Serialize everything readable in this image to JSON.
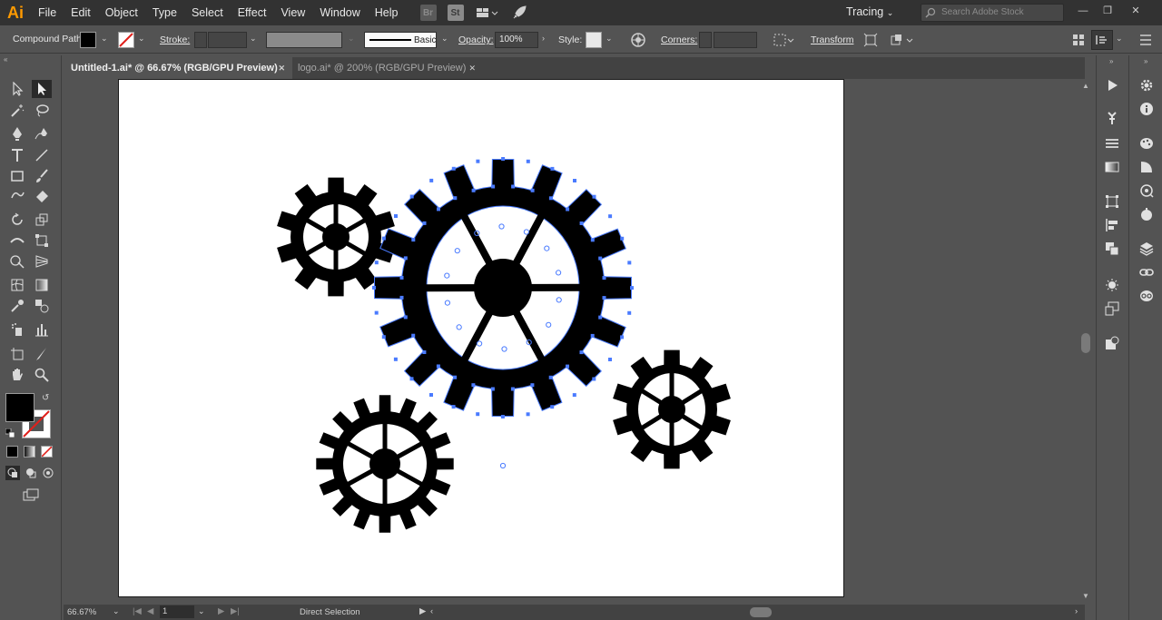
{
  "app": {
    "logo": "Ai"
  },
  "menu": [
    "File",
    "Edit",
    "Object",
    "Type",
    "Select",
    "Effect",
    "View",
    "Window",
    "Help"
  ],
  "menubar_icons": {
    "bridge": "Br",
    "stock": "St"
  },
  "workspace": "Tracing",
  "search_placeholder": "Search Adobe Stock",
  "control": {
    "selection_type": "Compound Path",
    "stroke_label": "Stroke:",
    "brush_label": "Basic",
    "opacity_label": "Opacity:",
    "opacity_value": "100%",
    "style_label": "Style:",
    "corners_label": "Corners:",
    "transform_label": "Transform"
  },
  "tabs": [
    {
      "label": "Untitled-1.ai* @ 66.67% (RGB/GPU Preview)",
      "active": true
    },
    {
      "label": "logo.ai* @ 200% (RGB/GPU Preview)",
      "active": false
    }
  ],
  "status": {
    "zoom": "66.67%",
    "artboard": "1",
    "tool": "Direct Selection"
  },
  "colors": {
    "fill": "#000000",
    "selection": "#4a7bff",
    "accent": "#ff9a00"
  }
}
